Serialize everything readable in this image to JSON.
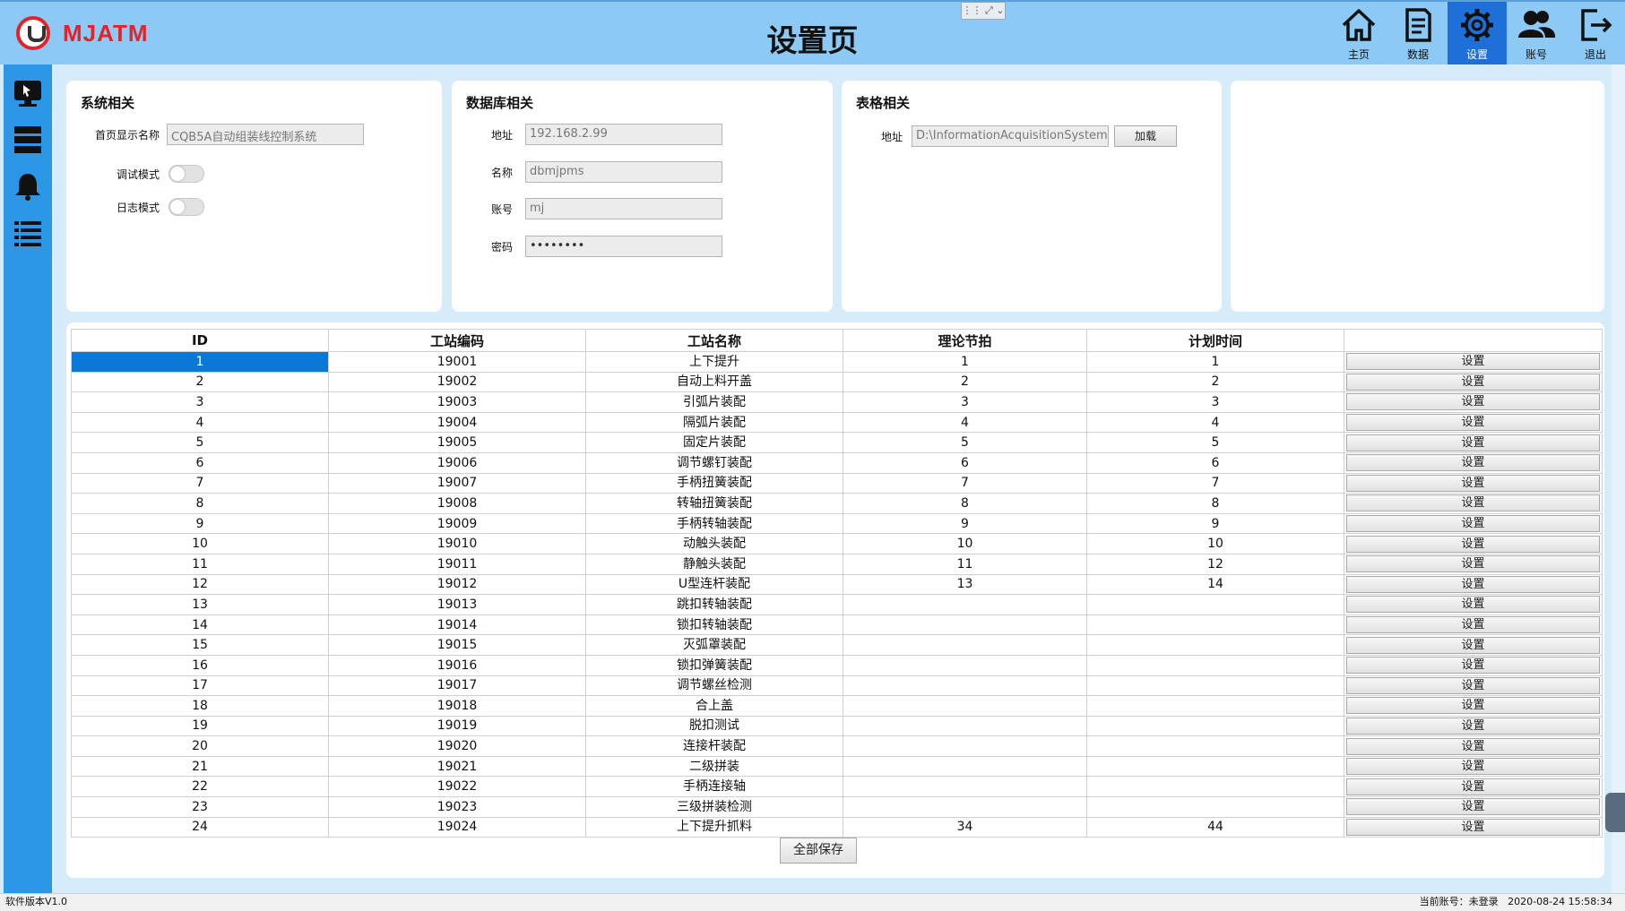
{
  "header": {
    "brand": "MJATM",
    "title": "设置页",
    "nav": [
      {
        "label": "主页",
        "icon": "home-icon"
      },
      {
        "label": "数据",
        "icon": "document-icon"
      },
      {
        "label": "设置",
        "icon": "gear-icon",
        "active": true
      },
      {
        "label": "账号",
        "icon": "users-icon"
      },
      {
        "label": "退出",
        "icon": "exit-icon"
      }
    ]
  },
  "sidebar": {
    "items": [
      {
        "icon": "monitor-icon"
      },
      {
        "icon": "server-icon"
      },
      {
        "icon": "bell-icon"
      },
      {
        "icon": "list-icon"
      }
    ]
  },
  "system_panel": {
    "title": "系统相关",
    "home_name_label": "首页显示名称",
    "home_name_value": "CQB5A自动组装线控制系统",
    "debug_label": "调试模式",
    "log_label": "日志模式"
  },
  "db_panel": {
    "title": "数据库相关",
    "address_label": "地址",
    "address_value": "192.168.2.99",
    "name_label": "名称",
    "name_value": "dbmjpms",
    "account_label": "账号",
    "account_value": "mj",
    "password_label": "密码",
    "password_value": "••••••••"
  },
  "sheet_panel": {
    "title": "表格相关",
    "address_label": "地址",
    "address_value": "D:\\InformationAcquisitionSystem\\",
    "load_button": "加载"
  },
  "table": {
    "headers": [
      "ID",
      "工站编码",
      "工站名称",
      "理论节拍",
      "计划时间",
      ""
    ],
    "button_label": "设置",
    "rows": [
      [
        "1",
        "19001",
        "上下提升",
        "1",
        "1"
      ],
      [
        "2",
        "19002",
        "自动上料开盖",
        "2",
        "2"
      ],
      [
        "3",
        "19003",
        "引弧片装配",
        "3",
        "3"
      ],
      [
        "4",
        "19004",
        "隔弧片装配",
        "4",
        "4"
      ],
      [
        "5",
        "19005",
        "固定片装配",
        "5",
        "5"
      ],
      [
        "6",
        "19006",
        "调节螺钉装配",
        "6",
        "6"
      ],
      [
        "7",
        "19007",
        "手柄扭簧装配",
        "7",
        "7"
      ],
      [
        "8",
        "19008",
        "转轴扭簧装配",
        "8",
        "8"
      ],
      [
        "9",
        "19009",
        "手柄转轴装配",
        "9",
        "9"
      ],
      [
        "10",
        "19010",
        "动触头装配",
        "10",
        "10"
      ],
      [
        "11",
        "19011",
        "静触头装配",
        "11",
        "12"
      ],
      [
        "12",
        "19012",
        "U型连杆装配",
        "13",
        "14"
      ],
      [
        "13",
        "19013",
        "跳扣转轴装配",
        "",
        ""
      ],
      [
        "14",
        "19014",
        "锁扣转轴装配",
        "",
        ""
      ],
      [
        "15",
        "19015",
        "灭弧罩装配",
        "",
        ""
      ],
      [
        "16",
        "19016",
        "锁扣弹簧装配",
        "",
        ""
      ],
      [
        "17",
        "19017",
        "调节螺丝检测",
        "",
        ""
      ],
      [
        "18",
        "19018",
        "合上盖",
        "",
        ""
      ],
      [
        "19",
        "19019",
        "脱扣测试",
        "",
        ""
      ],
      [
        "20",
        "19020",
        "连接杆装配",
        "",
        ""
      ],
      [
        "21",
        "19021",
        "二级拼装",
        "",
        ""
      ],
      [
        "22",
        "19022",
        "手柄连接轴",
        "",
        ""
      ],
      [
        "23",
        "19023",
        "三级拼装检测",
        "",
        ""
      ],
      [
        "24",
        "19024",
        "上下提升抓料",
        "34",
        "44"
      ]
    ],
    "save_all": "全部保存"
  },
  "status": {
    "version": "软件版本V1.0",
    "account_info": "当前账号：未登录",
    "datetime": "2020-08-24 15:58:34"
  },
  "colors": {
    "header_bg": "#8ccaf5",
    "sidebar_bg": "#2b97e6",
    "active_nav": "#1f6fd8",
    "selected_cell": "#0a78d7",
    "brand_red": "#e1242a"
  }
}
